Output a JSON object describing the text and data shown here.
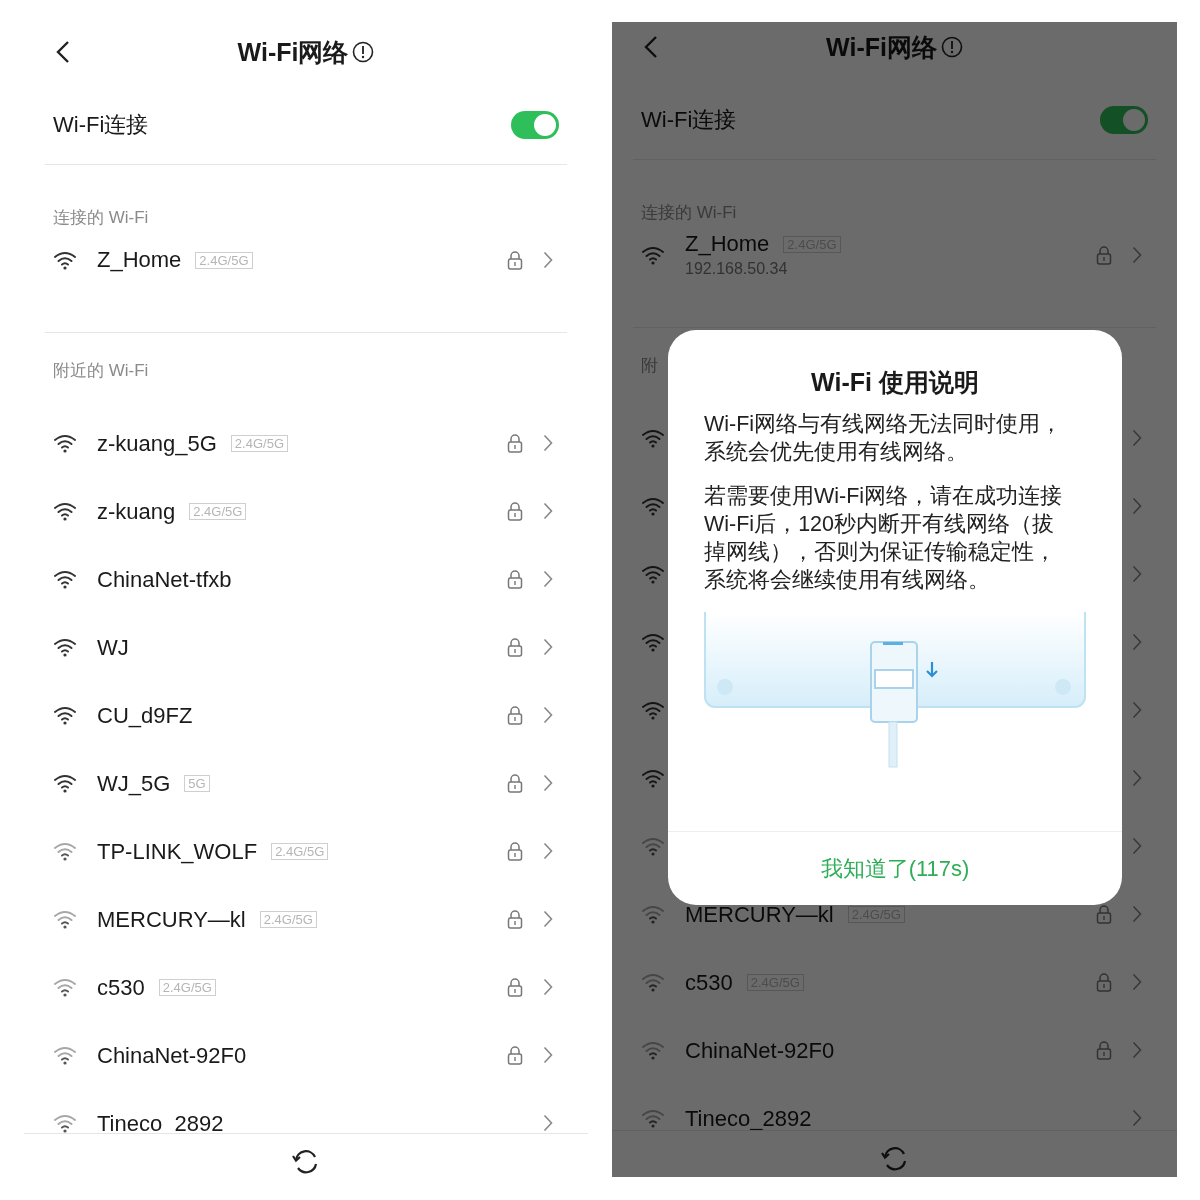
{
  "screens": [
    {
      "title": "Wi-Fi网络",
      "wifi_toggle": {
        "label": "Wi-Fi连接",
        "on": true
      },
      "connected": {
        "label": "连接的 Wi-Fi",
        "name": "Z_Home",
        "band": "2.4G/5G",
        "weak_signal": false,
        "locked": true
      },
      "nearby_label": "附近的 Wi-Fi",
      "networks": [
        {
          "name": "z-kuang_5G",
          "band": "2.4G/5G",
          "weak_signal": false,
          "locked": true
        },
        {
          "name": "z-kuang",
          "band": "2.4G/5G",
          "weak_signal": false,
          "locked": true
        },
        {
          "name": "ChinaNet-tfxb",
          "weak_signal": false,
          "locked": true
        },
        {
          "name": "WJ",
          "weak_signal": false,
          "locked": true
        },
        {
          "name": "CU_d9FZ",
          "weak_signal": false,
          "locked": true
        },
        {
          "name": "WJ_5G",
          "band": "5G",
          "weak_signal": false,
          "locked": true
        },
        {
          "name": "TP-LINK_WOLF",
          "band": "2.4G/5G",
          "weak_signal": true,
          "locked": true
        },
        {
          "name": "MERCURY—kl",
          "band": "2.4G/5G",
          "weak_signal": true,
          "locked": true
        },
        {
          "name": "c530",
          "band": "2.4G/5G",
          "weak_signal": true,
          "locked": true
        },
        {
          "name": "ChinaNet-92F0",
          "weak_signal": true,
          "locked": true
        },
        {
          "name": "Tineco_2892",
          "weak_signal": true,
          "locked": false
        }
      ]
    },
    {
      "title": "Wi-Fi网络",
      "wifi_toggle": {
        "label": "Wi-Fi连接",
        "on": true
      },
      "connected": {
        "label": "连接的 Wi-Fi",
        "name": "Z_Home",
        "band": "2.4G/5G",
        "ip": "192.168.50.34",
        "weak_signal": false,
        "locked": true
      },
      "nearby_label": "附",
      "networks": [
        {
          "weak_signal": false
        },
        {
          "weak_signal": false
        },
        {
          "weak_signal": false
        },
        {
          "weak_signal": false
        },
        {
          "weak_signal": false
        },
        {
          "weak_signal": false
        },
        {
          "weak_signal": true
        },
        {
          "name": "MERCURY—kl",
          "band": "2.4G/5G",
          "weak_signal": true,
          "locked": true
        },
        {
          "name": "c530",
          "band": "2.4G/5G",
          "weak_signal": true,
          "locked": true
        },
        {
          "name": "ChinaNet-92F0",
          "weak_signal": true,
          "locked": true
        },
        {
          "name": "Tineco_2892",
          "weak_signal": true,
          "locked": false
        }
      ],
      "dialog": {
        "title": "Wi-Fi 使用说明",
        "paragraphs": [
          "Wi-Fi网络与有线网络无法同时使用，系统会优先使用有线网络。",
          "若需要使用Wi-Fi网络，请在成功连接Wi-Fi后，120秒内断开有线网络（拔掉网线），否则为保证传输稳定性，系统将会继续使用有线网络。"
        ],
        "button": "我知道了(117s)"
      }
    }
  ]
}
